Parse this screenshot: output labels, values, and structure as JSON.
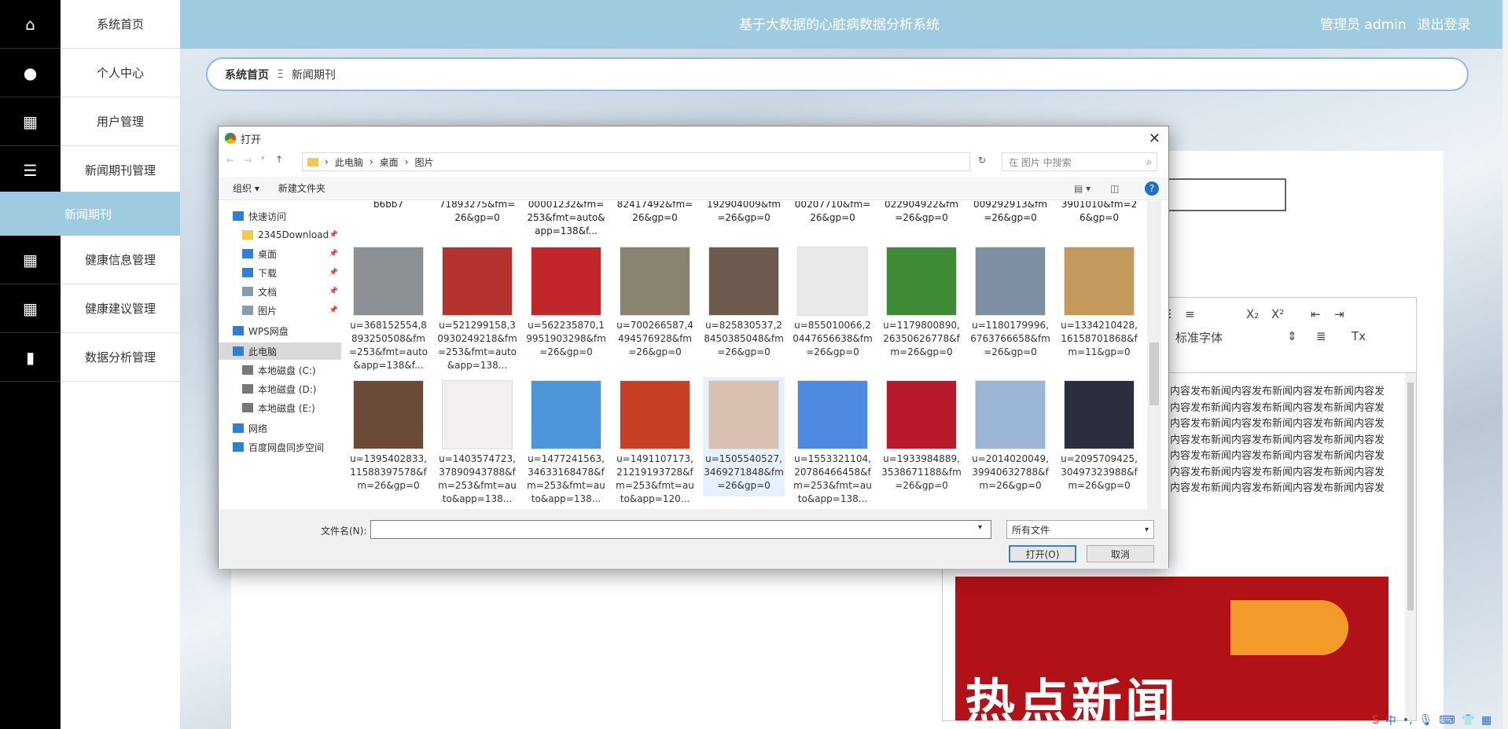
{
  "app": {
    "title": "基于大数据的心脏病数据分析系统",
    "user": "管理员 admin",
    "logout": "退出登录"
  },
  "sidebar": {
    "items": [
      {
        "label": "系统首页",
        "icon": "home-icon"
      },
      {
        "label": "个人中心",
        "icon": "person-icon"
      },
      {
        "label": "用户管理",
        "icon": "grid-icon"
      },
      {
        "label": "新闻期刊管理",
        "icon": "list-icon"
      },
      {
        "label": "健康信息管理",
        "icon": "grid-icon"
      },
      {
        "label": "健康建议管理",
        "icon": "grid-icon"
      },
      {
        "label": "数据分析管理",
        "icon": "book-icon"
      }
    ],
    "active": "新闻期刊"
  },
  "breadcrumb": {
    "home": "系统首页",
    "sep": "Ξ",
    "current": "新闻期刊"
  },
  "editor": {
    "heading_label": "标准字体",
    "text": "布新闻内容发布新闻内容发布新闻内容发布新闻内容发布新闻内容发布新闻内容发布新闻内容发布新闻内容发布新闻内容发布新闻内容发布新闻内容发布新闻内容发布新闻内容发布新闻内容发布新闻内容发布新闻内容发布新闻内容发布新闻内容发布新闻内容发布新闻内容发布新闻内容发布新闻内容发布新闻内容发布新闻内容发布新闻内容发布新闻内容发布新闻内容发布新闻内容发布新闻内容发布新闻内容发布新闻内容发布新闻内容发布新闻内容发布新闻内容发布新闻内容发布新闻内容发布新闻内容发布新闻内容发布新闻内容发布新闻内容发布新闻内容发布新闻内容发布新闻内容发布新闻内容发布新闻内容发布新闻内容发布新闻内容发布新闻内容发布新闻内容发布新闻内容",
    "banner_text": "热点新闻"
  },
  "dialog": {
    "title": "打开",
    "path": [
      "此电脑",
      "桌面",
      "图片"
    ],
    "search_placeholder": "在 图片 中搜索",
    "toolbar": {
      "organize": "组织 ▾",
      "new_folder": "新建文件夹"
    },
    "tree": [
      {
        "label": "快速访问",
        "icon": "star-icon",
        "pinned": false
      },
      {
        "label": "2345Download",
        "icon": "folder-icon",
        "pinned": true
      },
      {
        "label": "桌面",
        "icon": "desktop-icon",
        "pinned": true
      },
      {
        "label": "下载",
        "icon": "download-icon",
        "pinned": true
      },
      {
        "label": "文档",
        "icon": "document-icon",
        "pinned": true
      },
      {
        "label": "图片",
        "icon": "pictures-icon",
        "pinned": true
      },
      {
        "label": "WPS网盘",
        "icon": "cloud-icon",
        "pinned": false
      },
      {
        "label": "此电脑",
        "icon": "computer-icon",
        "pinned": false
      },
      {
        "label": "本地磁盘 (C:)",
        "icon": "disk-icon",
        "pinned": false
      },
      {
        "label": "本地磁盘 (D:)",
        "icon": "disk-icon",
        "pinned": false
      },
      {
        "label": "本地磁盘 (E:)",
        "icon": "disk-icon",
        "pinned": false
      },
      {
        "label": "网络",
        "icon": "network-icon",
        "pinned": false
      },
      {
        "label": "百度网盘同步空间",
        "icon": "sync-icon",
        "pinned": false
      }
    ],
    "top_row": [
      "b6bb7",
      "71893275&fm=26&gp=0",
      "00001232&fm=253&fmt=auto&app=138&f...",
      "82417492&fm=26&gp=0",
      "192904009&fm=26&gp=0",
      "00207710&fm=26&gp=0",
      "022904922&fm=26&gp=0",
      "009292913&fm=26&gp=0",
      "3901010&fm=26&gp=0"
    ],
    "files": [
      {
        "name": "u=368152554,8893250508&fm=253&fmt=auto&app=138&f...",
        "color": "#8c8f94"
      },
      {
        "name": "u=521299158,30930249218&fm=253&fmt=auto&app=138...",
        "color": "#b5332f"
      },
      {
        "name": "u=562235870,19951903298&fm=26&gp=0",
        "color": "#c0262a"
      },
      {
        "name": "u=700266587,4494576928&fm=26&gp=0",
        "color": "#8a8370"
      },
      {
        "name": "u=825830537,28450385048&fm=26&gp=0",
        "color": "#6b5a4d"
      },
      {
        "name": "u=855010066,20447656638&fm=26&gp=0",
        "color": "#e9e9e9"
      },
      {
        "name": "u=1179800890,26350626778&fm=26&gp=0",
        "color": "#3e8a35"
      },
      {
        "name": "u=1180179996,6763766658&fm=26&gp=0",
        "color": "#7f8fa3"
      },
      {
        "name": "u=1334210428,16158701868&fm=11&gp=0",
        "color": "#c49a5c"
      },
      {
        "name": "u=1395402833,11588397578&fm=26&gp=0",
        "color": "#6b4b37"
      },
      {
        "name": "u=1403574723,37890943788&fm=253&fmt=auto&app=138...",
        "color": "#f2efee"
      },
      {
        "name": "u=1477241563,34633168478&fm=253&fmt=auto&app=138...",
        "color": "#4a96d8"
      },
      {
        "name": "u=1491107173,21219193728&fm=253&fmt=auto&app=120...",
        "color": "#c83f23"
      },
      {
        "name": "u=1505540527,3469271848&fm=26&gp=0",
        "color": "#d9c1b2"
      },
      {
        "name": "u=1553321104,20786466458&fm=253&fmt=auto&app=138...",
        "color": "#4c89e0"
      },
      {
        "name": "u=1933984889,3538671188&fm=26&gp=0",
        "color": "#b71a2b"
      },
      {
        "name": "u=2014020049,39940632788&fm=26&gp=0",
        "color": "#9bb5d6"
      },
      {
        "name": "u=2095709425,30497323988&fm=26&gp=0",
        "color": "#2b2f3d"
      }
    ],
    "selected_index": 13,
    "filename_label": "文件名(N):",
    "filename_value": "",
    "filetype": "所有文件",
    "open_button": "打开(O)",
    "cancel_button": "取消"
  },
  "ime": {
    "label": "中"
  }
}
